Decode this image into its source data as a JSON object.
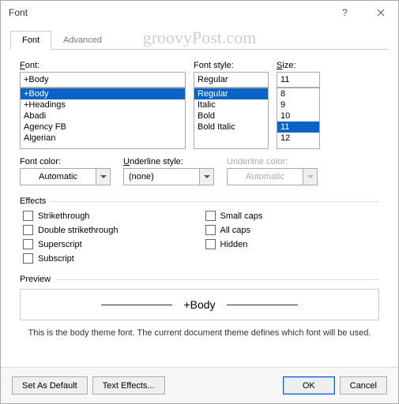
{
  "window": {
    "title": "Font"
  },
  "watermark": "groovyPost.com",
  "tabs": {
    "font": "Font",
    "advanced": "Advanced"
  },
  "labels": {
    "font": "Font:",
    "style": "Font style:",
    "size": "Size:",
    "font_color": "Font color:",
    "underline_style": "Underline style:",
    "underline_color": "Underline color:",
    "effects": "Effects",
    "preview": "Preview"
  },
  "font": {
    "value": "+Body",
    "options": [
      "+Body",
      "+Headings",
      "Abadi",
      "Agency FB",
      "Algerian"
    ],
    "selected": "+Body"
  },
  "style": {
    "value": "Regular",
    "options": [
      "Regular",
      "Italic",
      "Bold",
      "Bold Italic"
    ],
    "selected": "Regular"
  },
  "size": {
    "value": "11",
    "options": [
      "8",
      "9",
      "10",
      "11",
      "12"
    ],
    "selected": "11"
  },
  "font_color": {
    "value": "Automatic"
  },
  "underline_style": {
    "value": "(none)"
  },
  "underline_color": {
    "value": "Automatic"
  },
  "effects": {
    "strikethrough": "Strikethrough",
    "double_strikethrough": "Double strikethrough",
    "superscript": "Superscript",
    "subscript": "Subscript",
    "small_caps": "Small caps",
    "all_caps": "All caps",
    "hidden": "Hidden"
  },
  "preview": {
    "sample": "+Body",
    "desc": "This is the body theme font. The current document theme defines which font will be used."
  },
  "buttons": {
    "set_default": "Set As Default",
    "text_effects": "Text Effects...",
    "ok": "OK",
    "cancel": "Cancel"
  }
}
